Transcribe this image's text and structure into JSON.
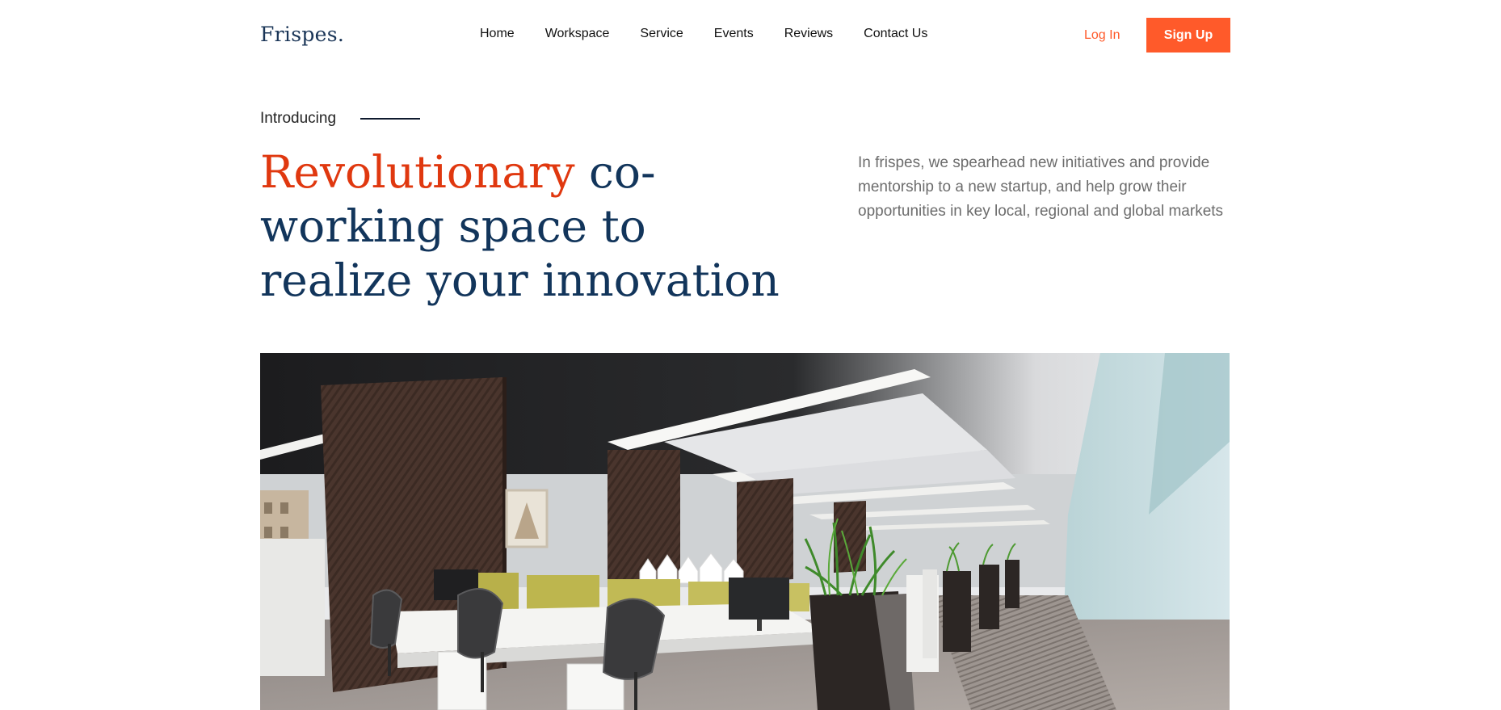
{
  "brand": {
    "logo": "Frispes."
  },
  "nav": {
    "items": [
      {
        "label": "Home"
      },
      {
        "label": "Workspace"
      },
      {
        "label": "Service"
      },
      {
        "label": "Events"
      },
      {
        "label": "Reviews"
      },
      {
        "label": "Contact Us"
      }
    ]
  },
  "auth": {
    "login_label": "Log In",
    "signup_label": "Sign Up"
  },
  "hero": {
    "eyebrow": "Introducing",
    "headline_accent": "Revolutionary",
    "headline_rest": " co-working space to realize your innovation",
    "description": "In frispes, we spearhead new initiatives and provide mentorship to a new startup, and help grow their opportunities in key local, regional and global markets"
  },
  "colors": {
    "accent": "#ff5a2a",
    "headline": "#12355b",
    "headline_accent": "#e0380f"
  }
}
